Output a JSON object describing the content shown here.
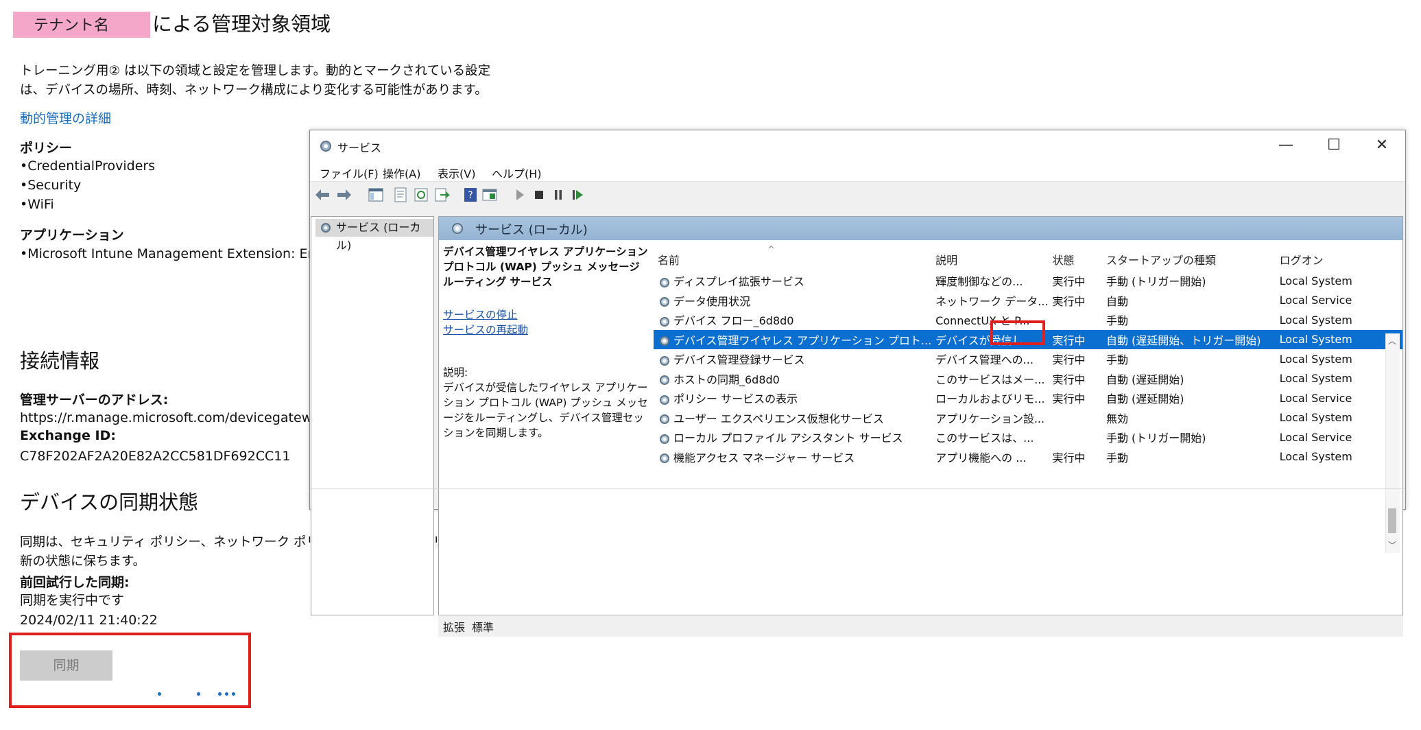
{
  "page": {
    "tenant_tag": "テナント名",
    "title": "による管理対象領域",
    "intro_line1": "トレーニング用② は以下の領域と設定を管理します。動的とマークされている設定",
    "intro_line2": "は、デバイスの場所、時刻、ネットワーク構成により変化する可能性があります。",
    "dynamic_link": "動的管理の詳細",
    "policy_heading": "ポリシー",
    "policies": [
      "•CredentialProviders",
      "•Security",
      "•WiFi"
    ],
    "app_heading": "アプリケーション",
    "apps": [
      "•Microsoft Intune Management Extension: Enf"
    ],
    "connection_heading": "接続情報",
    "server_label": "管理サーバーのアドレス:",
    "server_value": "https://r.manage.microsoft.com/devicegatewa",
    "exchange_label": "Exchange ID:",
    "exchange_value": "C78F202AF2A20E82A2CC581DF692CC11",
    "sync_heading": "デバイスの同期状態",
    "sync_desc_line1": "同期は、セキュリティ ポリシー、ネットワーク ポリシー、管理対象アプリケーションを最",
    "sync_desc_line2": "新の状態に保ちます。",
    "last_sync_label": "前回試行した同期:",
    "last_sync_status": "同期を実行中です",
    "last_sync_time": "2024/02/11 21:40:22",
    "sync_button": "同期"
  },
  "services_window": {
    "title": "サービス",
    "controls": {
      "minimize": "—",
      "maximize": "☐",
      "close": "✕"
    },
    "menu": [
      "ファイル(F)",
      "操作(A)",
      "表示(V)",
      "ヘルプ(H)"
    ],
    "tree_item": "サービス (ローカル)",
    "panel_title": "サービス (ローカル)",
    "selected_service_name": "デバイス管理ワイヤレス アプリケーション プロトコル (WAP) プッシュ メッセージ ルーティング サービス",
    "stop_link": "サービスの停止",
    "restart_link": "サービスの再起動",
    "desc_label": "説明:",
    "desc_text": "デバイスが受信したワイヤレス アプリケーション プロトコル (WAP) プッシュ メッセージをルーティングし、デバイス管理セッションを同期します。",
    "columns": [
      "名前",
      "説明",
      "状態",
      "スタートアップの種類",
      "ログオン"
    ],
    "sort_indicator": "^",
    "rows": [
      {
        "name": "ディスプレイ拡張サービス",
        "desc": "輝度制御などの...",
        "status": "実行中",
        "startup": "手動 (トリガー開始)",
        "logon": "Local System"
      },
      {
        "name": "データ使用状況",
        "desc": "ネットワーク データ...",
        "status": "実行中",
        "startup": "自動",
        "logon": "Local Service"
      },
      {
        "name": "デバイス フロー_6d8d0",
        "desc": "ConnectUX と P...",
        "status": "",
        "startup": "手動",
        "logon": "Local System"
      },
      {
        "name": "デバイス管理ワイヤレス アプリケーション プロト...",
        "desc": "デバイスが受信し...",
        "status": "実行中",
        "startup": "自動 (遅延開始、トリガー開始)",
        "logon": "Local System"
      },
      {
        "name": "デバイス管理登録サービス",
        "desc": "デバイス管理への...",
        "status": "実行中",
        "startup": "手動",
        "logon": "Local System"
      },
      {
        "name": "ホストの同期_6d8d0",
        "desc": "このサービスはメー...",
        "status": "実行中",
        "startup": "自動 (遅延開始)",
        "logon": "Local System"
      },
      {
        "name": "ポリシー サービスの表示",
        "desc": "ローカルおよびリモ...",
        "status": "実行中",
        "startup": "自動 (遅延開始)",
        "logon": "Local Service"
      },
      {
        "name": "ユーザー エクスペリエンス仮想化サービス",
        "desc": "アプリケーション設...",
        "status": "",
        "startup": "無効",
        "logon": "Local System"
      },
      {
        "name": "ローカル プロファイル アシスタント サービス",
        "desc": "このサービスは、...",
        "status": "",
        "startup": "手動 (トリガー開始)",
        "logon": "Local Service"
      },
      {
        "name": "機能アクセス マネージャー サービス",
        "desc": "アプリ機能への ...",
        "status": "実行中",
        "startup": "手動",
        "logon": "Local System"
      }
    ],
    "tabs": [
      "拡張",
      "標準"
    ],
    "colors": {
      "selection": "#0a6fd1",
      "highlight_box": "#e0201f"
    }
  }
}
